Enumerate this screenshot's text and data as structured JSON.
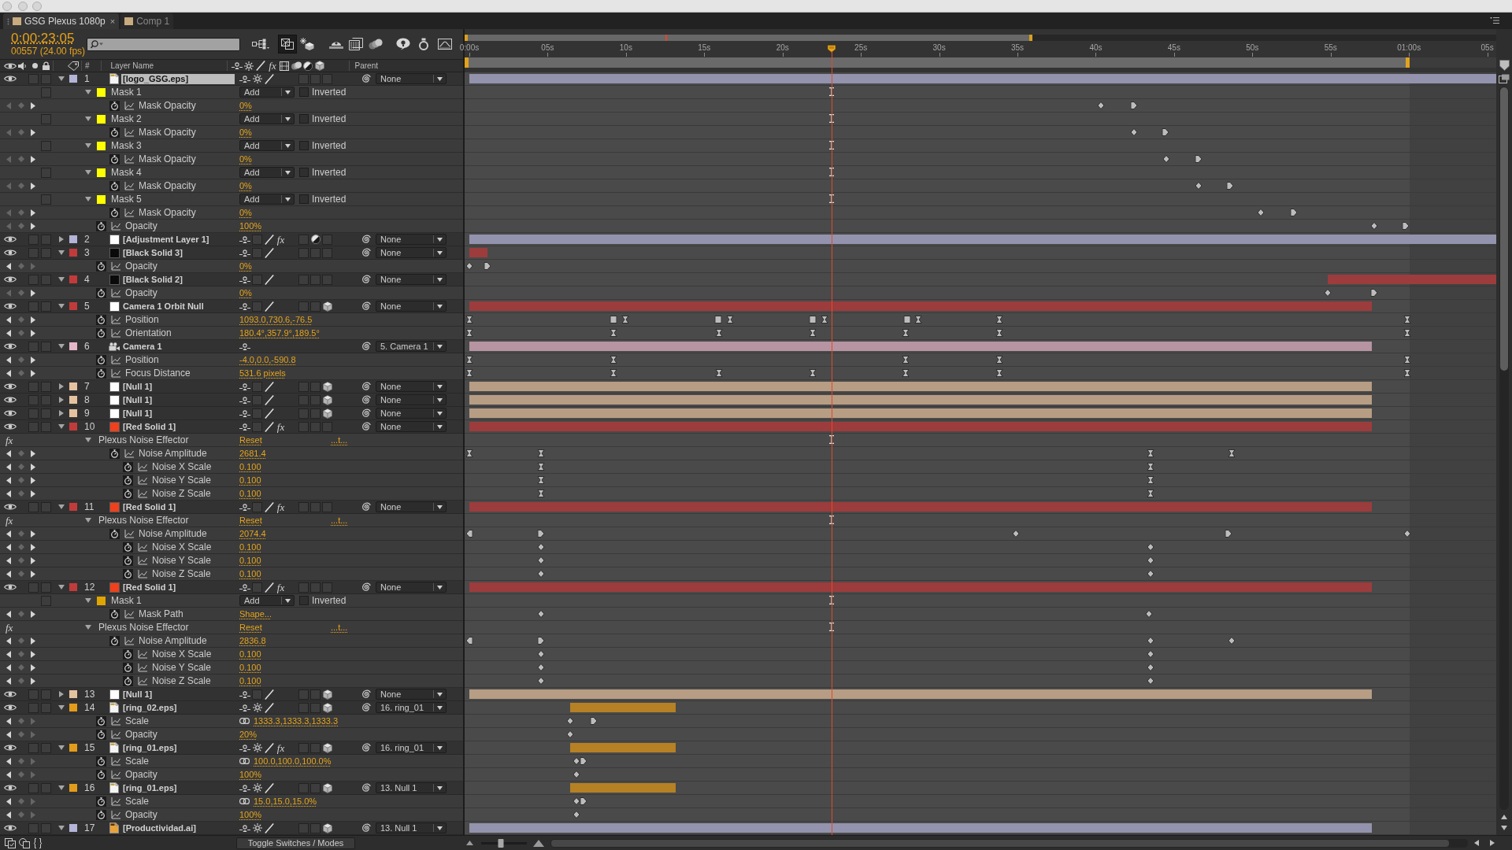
{
  "tabs": [
    {
      "label": "GSG Plexus 1080p",
      "selected": true,
      "close": "×"
    },
    {
      "label": "Comp 1",
      "selected": false
    }
  ],
  "timecode": {
    "time": "0:00:23:05",
    "frames": "00557 (24.00 fps)"
  },
  "columns": {
    "number": "#",
    "layer_name": "Layer Name",
    "effects_switch": "fx",
    "parent": "Parent"
  },
  "ruler": [
    "0:00s",
    "05s",
    "10s",
    "15s",
    "20s",
    "25s",
    "30s",
    "35s",
    "40s",
    "45s",
    "50s",
    "55s",
    "01:00s",
    "05s"
  ],
  "playhead": {
    "level": 0.353
  },
  "work_area": {
    "level": 0.916
  },
  "layers": [
    {
      "number": "1",
      "name": "[logo_GSG.eps]",
      "color": "#b4b4d8",
      "visible": true,
      "selected": true,
      "expanded": true,
      "source": {
        "kind": "eps"
      },
      "switches": {
        "collapse": true,
        "adjustment": false,
        "three_d": false
      },
      "parent": "None",
      "bar": {
        "kind": "full"
      },
      "children": [
        {
          "kind": "mask",
          "name": "Mask 1",
          "color": "#ffff00",
          "expanded": true,
          "mode": "Add",
          "inverted": {
            "label": "Inverted",
            "checked": false
          },
          "children": [
            {
              "kind": "property",
              "name": "Mask Opacity",
              "value": "0%",
              "keyframes": [
                {
                  "kind": "diamond",
                  "level": 0.615
                },
                {
                  "kind": "right",
                  "level": 0.647
                }
              ]
            }
          ]
        },
        {
          "kind": "mask",
          "name": "Mask 2",
          "color": "#ffff00",
          "expanded": true,
          "mode": "Add",
          "inverted": {
            "label": "Inverted",
            "checked": false
          },
          "children": [
            {
              "kind": "property",
              "name": "Mask Opacity",
              "value": "0%",
              "keyframes": [
                {
                  "kind": "diamond",
                  "level": 0.647
                },
                {
                  "kind": "right",
                  "level": 0.678
                }
              ]
            }
          ]
        },
        {
          "kind": "mask",
          "name": "Mask 3",
          "color": "#ffff00",
          "expanded": true,
          "mode": "Add",
          "inverted": {
            "label": "Inverted",
            "checked": false
          },
          "children": [
            {
              "kind": "property",
              "name": "Mask Opacity",
              "value": "0%",
              "keyframes": [
                {
                  "kind": "diamond",
                  "level": 0.679
                },
                {
                  "kind": "right",
                  "level": 0.71
                }
              ]
            }
          ]
        },
        {
          "kind": "mask",
          "name": "Mask 4",
          "color": "#ffff00",
          "expanded": true,
          "mode": "Add",
          "inverted": {
            "label": "Inverted",
            "checked": false
          },
          "children": [
            {
              "kind": "property",
              "name": "Mask Opacity",
              "value": "0%",
              "keyframes": [
                {
                  "kind": "diamond",
                  "level": 0.71
                },
                {
                  "kind": "right",
                  "level": 0.741
                }
              ]
            }
          ]
        },
        {
          "kind": "mask",
          "name": "Mask 5",
          "color": "#ffff00",
          "expanded": true,
          "mode": "Add",
          "inverted": {
            "label": "Inverted",
            "checked": false
          },
          "children": [
            {
              "kind": "property",
              "name": "Mask Opacity",
              "value": "0%",
              "keyframes": [
                {
                  "kind": "diamond",
                  "level": 0.771
                },
                {
                  "kind": "right",
                  "level": 0.803
                }
              ]
            }
          ]
        },
        {
          "kind": "property",
          "name": "Opacity",
          "value": "100%",
          "keyframes": [
            {
              "kind": "diamond",
              "level": 0.881
            },
            {
              "kind": "right",
              "level": 0.912
            }
          ]
        }
      ]
    },
    {
      "number": "2",
      "name": "[Adjustment Layer 1]",
      "color": "#b4b4d8",
      "visible": true,
      "selected": false,
      "expanded": false,
      "source": {
        "kind": "solid",
        "color": "#ffffff"
      },
      "switches": {
        "collapse": false,
        "fx": {
          "label": "fx",
          "on": true
        },
        "adjustment": true,
        "three_d": false
      },
      "parent": "None",
      "bar": {
        "kind": "full"
      }
    },
    {
      "number": "3",
      "name": "[Black Solid 3]",
      "color": "#c23b3b",
      "visible": true,
      "selected": false,
      "expanded": true,
      "source": {
        "kind": "solid",
        "color": "#0a0a0a"
      },
      "switches": {
        "collapse": false,
        "adjustment": false,
        "three_d": false
      },
      "parent": "None",
      "bar": {
        "kind": "head"
      },
      "children": [
        {
          "kind": "property",
          "name": "Opacity",
          "value": "0%",
          "keyframes": [
            {
              "kind": "diamond",
              "level": 0
            },
            {
              "kind": "right",
              "level": 0.018
            }
          ]
        }
      ]
    },
    {
      "number": "4",
      "name": "[Black Solid 2]",
      "color": "#c23b3b",
      "visible": true,
      "selected": false,
      "expanded": true,
      "source": {
        "kind": "solid",
        "color": "#0a0a0a"
      },
      "switches": {
        "collapse": false,
        "adjustment": false,
        "three_d": false
      },
      "parent": "None",
      "bar": {
        "kind": "tail"
      },
      "children": [
        {
          "kind": "property",
          "name": "Opacity",
          "value": "0%",
          "keyframes": [
            {
              "kind": "diamond",
              "level": 0.836
            },
            {
              "kind": "right",
              "level": 0.881
            }
          ]
        }
      ]
    },
    {
      "number": "5",
      "name": "Camera 1 Orbit Null",
      "color": "#c23b3b",
      "visible": true,
      "selected": false,
      "expanded": true,
      "source": {
        "kind": "solid",
        "color": "#ffffff"
      },
      "switches": {
        "collapse": false,
        "adjustment": false,
        "three_d": true
      },
      "parent": "None",
      "bar": {
        "kind": "comp"
      },
      "children": [
        {
          "kind": "property",
          "name": "Position",
          "value": "1093.0,730.6,-76.5",
          "keyframes": [
            {
              "kind": "hourglass",
              "level": 0
            },
            {
              "kind": "hold",
              "level": 0.14
            },
            {
              "kind": "hourglass",
              "level": 0.152
            },
            {
              "kind": "hold",
              "level": 0.242
            },
            {
              "kind": "hourglass",
              "level": 0.254
            },
            {
              "kind": "hold",
              "level": 0.334
            },
            {
              "kind": "hourglass",
              "level": 0.346
            },
            {
              "kind": "hold",
              "level": 0.426
            },
            {
              "kind": "hourglass",
              "level": 0.437
            },
            {
              "kind": "hourglass",
              "level": 0.516
            },
            {
              "kind": "hourglass",
              "level": 0.913
            }
          ]
        },
        {
          "kind": "property",
          "name": "Orientation",
          "value": "180.4°,357.9°,189.5°",
          "keyframes": [
            {
              "kind": "hourglass",
              "level": 0
            },
            {
              "kind": "hourglass",
              "level": 0.14
            },
            {
              "kind": "hourglass",
              "level": 0.243
            },
            {
              "kind": "hourglass",
              "level": 0.334
            },
            {
              "kind": "hourglass",
              "level": 0.425
            },
            {
              "kind": "hourglass",
              "level": 0.516
            },
            {
              "kind": "hourglass",
              "level": 0.913
            }
          ]
        }
      ]
    },
    {
      "number": "6",
      "name": "Camera 1",
      "color": "#e6b6c8",
      "visible": true,
      "selected": false,
      "expanded": true,
      "source": {
        "kind": "camera"
      },
      "parent": "5. Camera 1",
      "bar": {
        "kind": "comp"
      },
      "children": [
        {
          "kind": "property",
          "name": "Position",
          "value": "-4.0,0.0,-590.8",
          "keyframes": [
            {
              "kind": "hourglass",
              "level": 0
            },
            {
              "kind": "hourglass",
              "level": 0.14
            },
            {
              "kind": "hourglass",
              "level": 0.425
            },
            {
              "kind": "hourglass",
              "level": 0.516
            },
            {
              "kind": "hourglass",
              "level": 0.913
            }
          ]
        },
        {
          "kind": "property",
          "name": "Focus Distance",
          "value": "531.6 pixels",
          "keyframes": [
            {
              "kind": "hourglass",
              "level": 0
            },
            {
              "kind": "hourglass",
              "level": 0.14
            },
            {
              "kind": "hourglass",
              "level": 0.243
            },
            {
              "kind": "hourglass",
              "level": 0.334
            },
            {
              "kind": "hourglass",
              "level": 0.425
            },
            {
              "kind": "hourglass",
              "level": 0.516
            },
            {
              "kind": "hourglass",
              "level": 0.913
            }
          ]
        }
      ]
    },
    {
      "number": "7",
      "name": "[Null 1]",
      "color": "#e6c3a0",
      "visible": true,
      "selected": false,
      "expanded": false,
      "source": {
        "kind": "solid",
        "color": "#ffffff"
      },
      "switches": {
        "collapse": false,
        "adjustment": false,
        "three_d": true
      },
      "parent": "None",
      "bar": {
        "kind": "comp"
      }
    },
    {
      "number": "8",
      "name": "[Null 1]",
      "color": "#e6c3a0",
      "visible": true,
      "selected": false,
      "expanded": false,
      "source": {
        "kind": "solid",
        "color": "#ffffff"
      },
      "switches": {
        "collapse": false,
        "adjustment": false,
        "three_d": true
      },
      "parent": "None",
      "bar": {
        "kind": "comp"
      }
    },
    {
      "number": "9",
      "name": "[Null 1]",
      "color": "#e6c3a0",
      "visible": true,
      "selected": false,
      "expanded": false,
      "source": {
        "kind": "solid",
        "color": "#ffffff"
      },
      "switches": {
        "collapse": false,
        "adjustment": false,
        "three_d": true
      },
      "parent": "None",
      "bar": {
        "kind": "comp"
      }
    },
    {
      "number": "10",
      "name": "[Red Solid 1]",
      "color": "#c23b3b",
      "visible": true,
      "selected": false,
      "expanded": true,
      "source": {
        "kind": "solid",
        "color": "#f0401c"
      },
      "switches": {
        "collapse": false,
        "fx": {
          "label": "fx",
          "on": true
        },
        "adjustment": false,
        "three_d": false
      },
      "parent": "None",
      "bar": {
        "kind": "comp"
      },
      "children": [
        {
          "kind": "effect",
          "name": "Plexus Noise Effector",
          "switch": {
            "label": "fx",
            "on": true
          },
          "expanded": true,
          "reset": "Reset",
          "about": "...t...",
          "children": [
            {
              "kind": "property",
              "name": "Noise Amplitude",
              "value": "2681.4",
              "keyframes": [
                {
                  "kind": "hourglass",
                  "level": 0
                },
                {
                  "kind": "hourglass",
                  "level": 0.07
                },
                {
                  "kind": "hourglass",
                  "level": 0.663
                },
                {
                  "kind": "hourglass",
                  "level": 0.742
                }
              ],
              "children": [
                {
                  "kind": "property",
                  "name": "Noise X Scale",
                  "value": "0.100",
                  "keyframes": [
                    {
                      "kind": "hourglass",
                      "level": 0.07
                    },
                    {
                      "kind": "hourglass",
                      "level": 0.663
                    }
                  ]
                },
                {
                  "kind": "property",
                  "name": "Noise Y Scale",
                  "value": "0.100",
                  "keyframes": [
                    {
                      "kind": "hourglass",
                      "level": 0.07
                    },
                    {
                      "kind": "hourglass",
                      "level": 0.663
                    }
                  ]
                },
                {
                  "kind": "property",
                  "name": "Noise Z Scale",
                  "value": "0.100",
                  "keyframes": [
                    {
                      "kind": "hourglass",
                      "level": 0.07
                    },
                    {
                      "kind": "hourglass",
                      "level": 0.663
                    }
                  ]
                }
              ]
            }
          ]
        }
      ]
    },
    {
      "number": "11",
      "name": "[Red Solid 1]",
      "color": "#c23b3b",
      "visible": true,
      "selected": false,
      "expanded": true,
      "source": {
        "kind": "solid",
        "color": "#f0401c"
      },
      "switches": {
        "collapse": false,
        "fx": {
          "label": "fx",
          "on": true
        },
        "adjustment": false,
        "three_d": false
      },
      "parent": "None",
      "bar": {
        "kind": "comp"
      },
      "children": [
        {
          "kind": "effect",
          "name": "Plexus Noise Effector",
          "switch": {
            "label": "fx",
            "on": true
          },
          "expanded": true,
          "reset": "Reset",
          "about": "...t...",
          "children": [
            {
              "kind": "property",
              "name": "Noise Amplitude",
              "value": "2074.4",
              "keyframes": [
                {
                  "kind": "left",
                  "level": 0
                },
                {
                  "kind": "right",
                  "level": 0.07
                },
                {
                  "kind": "diamond",
                  "level": 0.532
                },
                {
                  "kind": "right",
                  "level": 0.739
                },
                {
                  "kind": "diamond",
                  "level": 0.913
                }
              ],
              "children": [
                {
                  "kind": "property",
                  "name": "Noise X Scale",
                  "value": "0.100",
                  "keyframes": [
                    {
                      "kind": "diamond",
                      "level": 0.07
                    },
                    {
                      "kind": "diamond",
                      "level": 0.663
                    }
                  ]
                },
                {
                  "kind": "property",
                  "name": "Noise Y Scale",
                  "value": "0.100",
                  "keyframes": [
                    {
                      "kind": "diamond",
                      "level": 0.07
                    },
                    {
                      "kind": "diamond",
                      "level": 0.663
                    }
                  ]
                },
                {
                  "kind": "property",
                  "name": "Noise Z Scale",
                  "value": "0.100",
                  "keyframes": [
                    {
                      "kind": "diamond",
                      "level": 0.07
                    },
                    {
                      "kind": "diamond",
                      "level": 0.663
                    }
                  ]
                }
              ]
            }
          ]
        }
      ]
    },
    {
      "number": "12",
      "name": "[Red Solid 1]",
      "color": "#c23b3b",
      "visible": true,
      "selected": false,
      "expanded": true,
      "source": {
        "kind": "solid",
        "color": "#f0401c"
      },
      "switches": {
        "collapse": false,
        "fx": {
          "label": "fx",
          "on": true
        },
        "adjustment": false,
        "three_d": false
      },
      "parent": "None",
      "bar": {
        "kind": "comp"
      },
      "children": [
        {
          "kind": "mask",
          "name": "Mask 1",
          "color": "#e0a500",
          "expanded": true,
          "mode": "Add",
          "inverted": {
            "label": "Inverted",
            "checked": false
          },
          "children": [
            {
              "kind": "property",
              "name": "Mask Path",
              "value": "Shape...",
              "keyframes": [
                {
                  "kind": "diamond",
                  "level": 0.07
                },
                {
                  "kind": "diamond",
                  "level": 0.662
                }
              ]
            }
          ]
        },
        {
          "kind": "effect",
          "name": "Plexus Noise Effector",
          "switch": {
            "label": "fx",
            "on": true
          },
          "expanded": true,
          "reset": "Reset",
          "about": "...t...",
          "children": [
            {
              "kind": "property",
              "name": "Noise Amplitude",
              "value": "2836.8",
              "keyframes": [
                {
                  "kind": "left",
                  "level": 0
                },
                {
                  "kind": "right",
                  "level": 0.07
                },
                {
                  "kind": "diamond",
                  "level": 0.663
                },
                {
                  "kind": "diamond",
                  "level": 0.742
                }
              ],
              "children": [
                {
                  "kind": "property",
                  "name": "Noise X Scale",
                  "value": "0.100",
                  "keyframes": [
                    {
                      "kind": "diamond",
                      "level": 0.07
                    },
                    {
                      "kind": "diamond",
                      "level": 0.663
                    }
                  ]
                },
                {
                  "kind": "property",
                  "name": "Noise Y Scale",
                  "value": "0.100",
                  "keyframes": [
                    {
                      "kind": "diamond",
                      "level": 0.07
                    },
                    {
                      "kind": "diamond",
                      "level": 0.663
                    }
                  ]
                },
                {
                  "kind": "property",
                  "name": "Noise Z Scale",
                  "value": "0.100",
                  "keyframes": [
                    {
                      "kind": "diamond",
                      "level": 0.07
                    },
                    {
                      "kind": "diamond",
                      "level": 0.663
                    }
                  ]
                }
              ]
            }
          ]
        }
      ]
    },
    {
      "number": "13",
      "name": "[Null 1]",
      "color": "#e6c3a0",
      "visible": true,
      "selected": false,
      "expanded": false,
      "source": {
        "kind": "solid",
        "color": "#ffffff"
      },
      "switches": {
        "collapse": false,
        "adjustment": false,
        "three_d": true
      },
      "parent": "None",
      "bar": {
        "kind": "comp"
      }
    },
    {
      "number": "14",
      "name": "[ring_02.eps]",
      "color": "#e39c1a",
      "visible": true,
      "selected": false,
      "expanded": true,
      "source": {
        "kind": "eps"
      },
      "switches": {
        "collapse": true,
        "adjustment": false,
        "three_d": true
      },
      "parent": "16. ring_01",
      "bar": {
        "kind": "ring"
      },
      "children": [
        {
          "kind": "property",
          "name": "Scale",
          "linked": true,
          "value": "1333.3,1333.3,1333.3",
          "keyframes": [
            {
              "kind": "diamond",
              "level": 0.098
            },
            {
              "kind": "right",
              "level": 0.121
            }
          ]
        },
        {
          "kind": "property",
          "name": "Opacity",
          "value": "20%",
          "keyframes": [
            {
              "kind": "diamond",
              "level": 0.098
            }
          ]
        }
      ]
    },
    {
      "number": "15",
      "name": "[ring_01.eps]",
      "color": "#e39c1a",
      "visible": true,
      "selected": false,
      "expanded": true,
      "source": {
        "kind": "eps"
      },
      "switches": {
        "collapse": true,
        "fx": {
          "label": "fx",
          "on": true
        },
        "adjustment": false,
        "three_d": true
      },
      "parent": "16. ring_01",
      "bar": {
        "kind": "ring"
      },
      "children": [
        {
          "kind": "property",
          "name": "Scale",
          "linked": true,
          "value": "100.0,100.0,100.0%",
          "keyframes": [
            {
              "kind": "diamond",
              "level": 0.104
            },
            {
              "kind": "right",
              "level": 0.111
            }
          ]
        },
        {
          "kind": "property",
          "name": "Opacity",
          "value": "100%",
          "keyframes": [
            {
              "kind": "diamond",
              "level": 0.104
            }
          ]
        }
      ]
    },
    {
      "number": "16",
      "name": "[ring_01.eps]",
      "color": "#e39c1a",
      "visible": true,
      "selected": false,
      "expanded": true,
      "source": {
        "kind": "eps"
      },
      "switches": {
        "collapse": true,
        "adjustment": false,
        "three_d": true
      },
      "parent": "13. Null 1",
      "bar": {
        "kind": "ring"
      },
      "children": [
        {
          "kind": "property",
          "name": "Scale",
          "linked": true,
          "value": "15.0,15.0,15.0%",
          "keyframes": [
            {
              "kind": "diamond",
              "level": 0.104
            },
            {
              "kind": "right",
              "level": 0.111
            }
          ]
        },
        {
          "kind": "property",
          "name": "Opacity",
          "value": "100%",
          "keyframes": [
            {
              "kind": "diamond",
              "level": 0.104
            }
          ]
        }
      ]
    },
    {
      "number": "17",
      "name": "[Productividad.ai]",
      "color": "#b4b4d8",
      "visible": true,
      "selected": false,
      "expanded": true,
      "source": {
        "kind": "ai"
      },
      "switches": {
        "collapse": true,
        "adjustment": false,
        "three_d": true
      },
      "parent": "13. Null 1",
      "bar": {
        "kind": "comp"
      }
    }
  ],
  "footer": {
    "toggle": "Toggle Switches / Modes",
    "zoom": {
      "level": 0.43
    }
  }
}
